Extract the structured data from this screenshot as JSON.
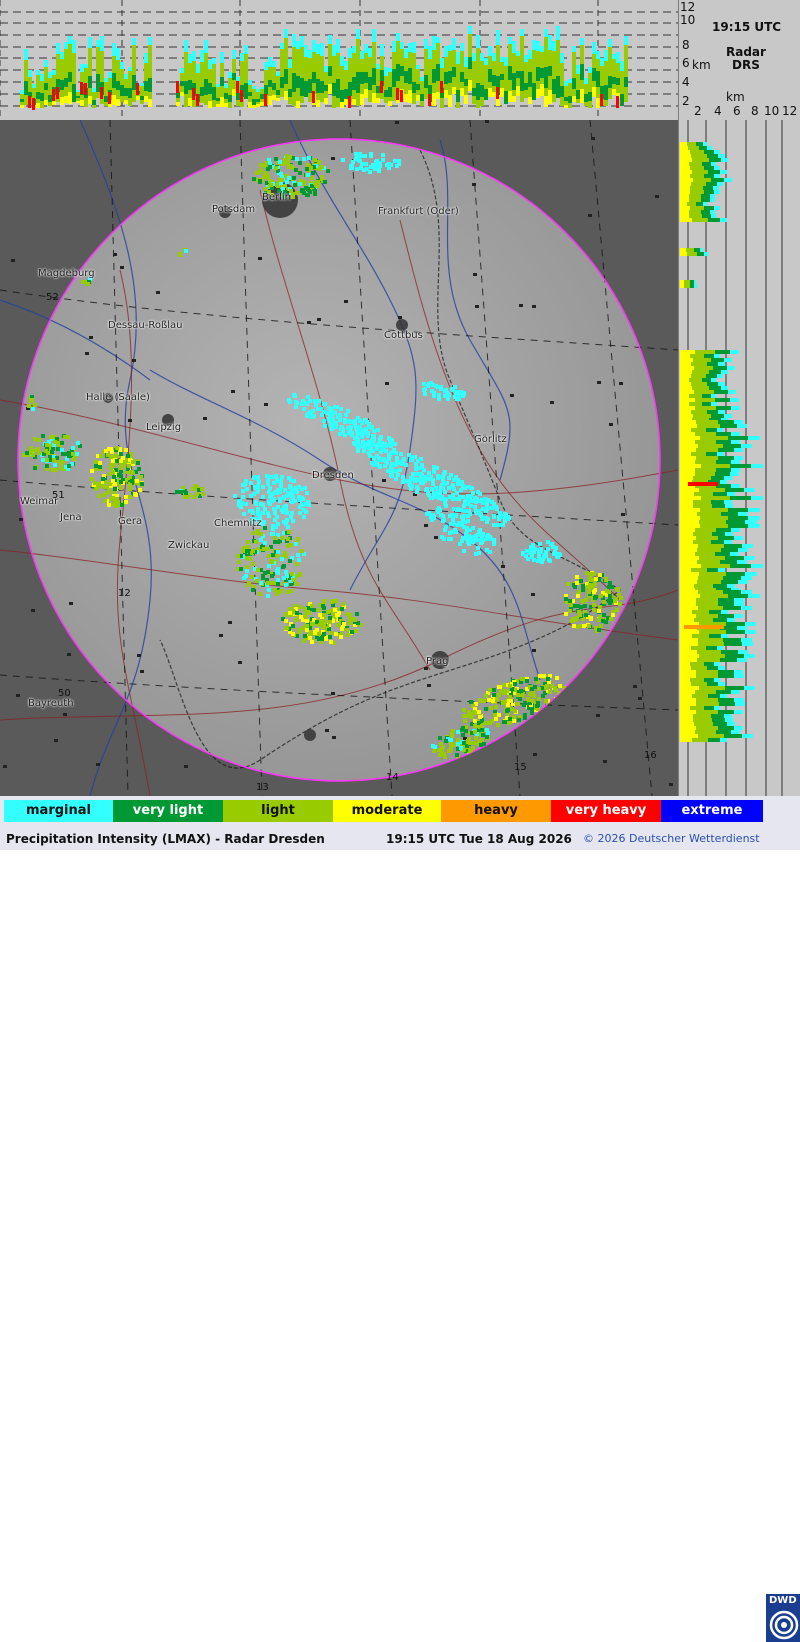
{
  "header": {
    "time": "19:15 UTC",
    "radar_label": "Radar",
    "radar_code": "DRS",
    "unit": "km",
    "top_axis_ticks": [
      "12",
      "10",
      "8",
      "6",
      "4",
      "2"
    ],
    "right_axis_ticks": [
      "2",
      "4",
      "6",
      "8",
      "10",
      "12"
    ]
  },
  "map": {
    "cities": [
      {
        "name": "Berlin"
      },
      {
        "name": "Potsdam"
      },
      {
        "name": "Frankfurt (Oder)"
      },
      {
        "name": "Magdeburg"
      },
      {
        "name": "Dessau-Roßlau"
      },
      {
        "name": "Cottbus"
      },
      {
        "name": "Halle (Saale)"
      },
      {
        "name": "Leipzig"
      },
      {
        "name": "Görlitz"
      },
      {
        "name": "Dresden"
      },
      {
        "name": "Weimar"
      },
      {
        "name": "Jena"
      },
      {
        "name": "Gera"
      },
      {
        "name": "Chemnitz"
      },
      {
        "name": "Zwickau"
      },
      {
        "name": "Prag"
      },
      {
        "name": "Bayreuth"
      }
    ],
    "grid_labels": [
      "52",
      "51",
      "50",
      "12",
      "13",
      "14",
      "15",
      "16"
    ]
  },
  "legend": {
    "items": [
      {
        "label": "marginal",
        "color": "#33ffff"
      },
      {
        "label": "very light",
        "color": "#009933"
      },
      {
        "label": "light",
        "color": "#99cc00"
      },
      {
        "label": "moderate",
        "color": "#ffff00"
      },
      {
        "label": "heavy",
        "color": "#ff9900"
      },
      {
        "label": "very heavy",
        "color": "#ff0000"
      },
      {
        "label": "extreme",
        "color": "#0000ff"
      }
    ]
  },
  "footer": {
    "title": "Precipitation Intensity (LMAX) - Radar Dresden",
    "datetime": "19:15 UTC Tue 18 Aug 2026",
    "copyright": "© 2026 Deutscher Wetterdienst",
    "logo_text": "DWD"
  }
}
